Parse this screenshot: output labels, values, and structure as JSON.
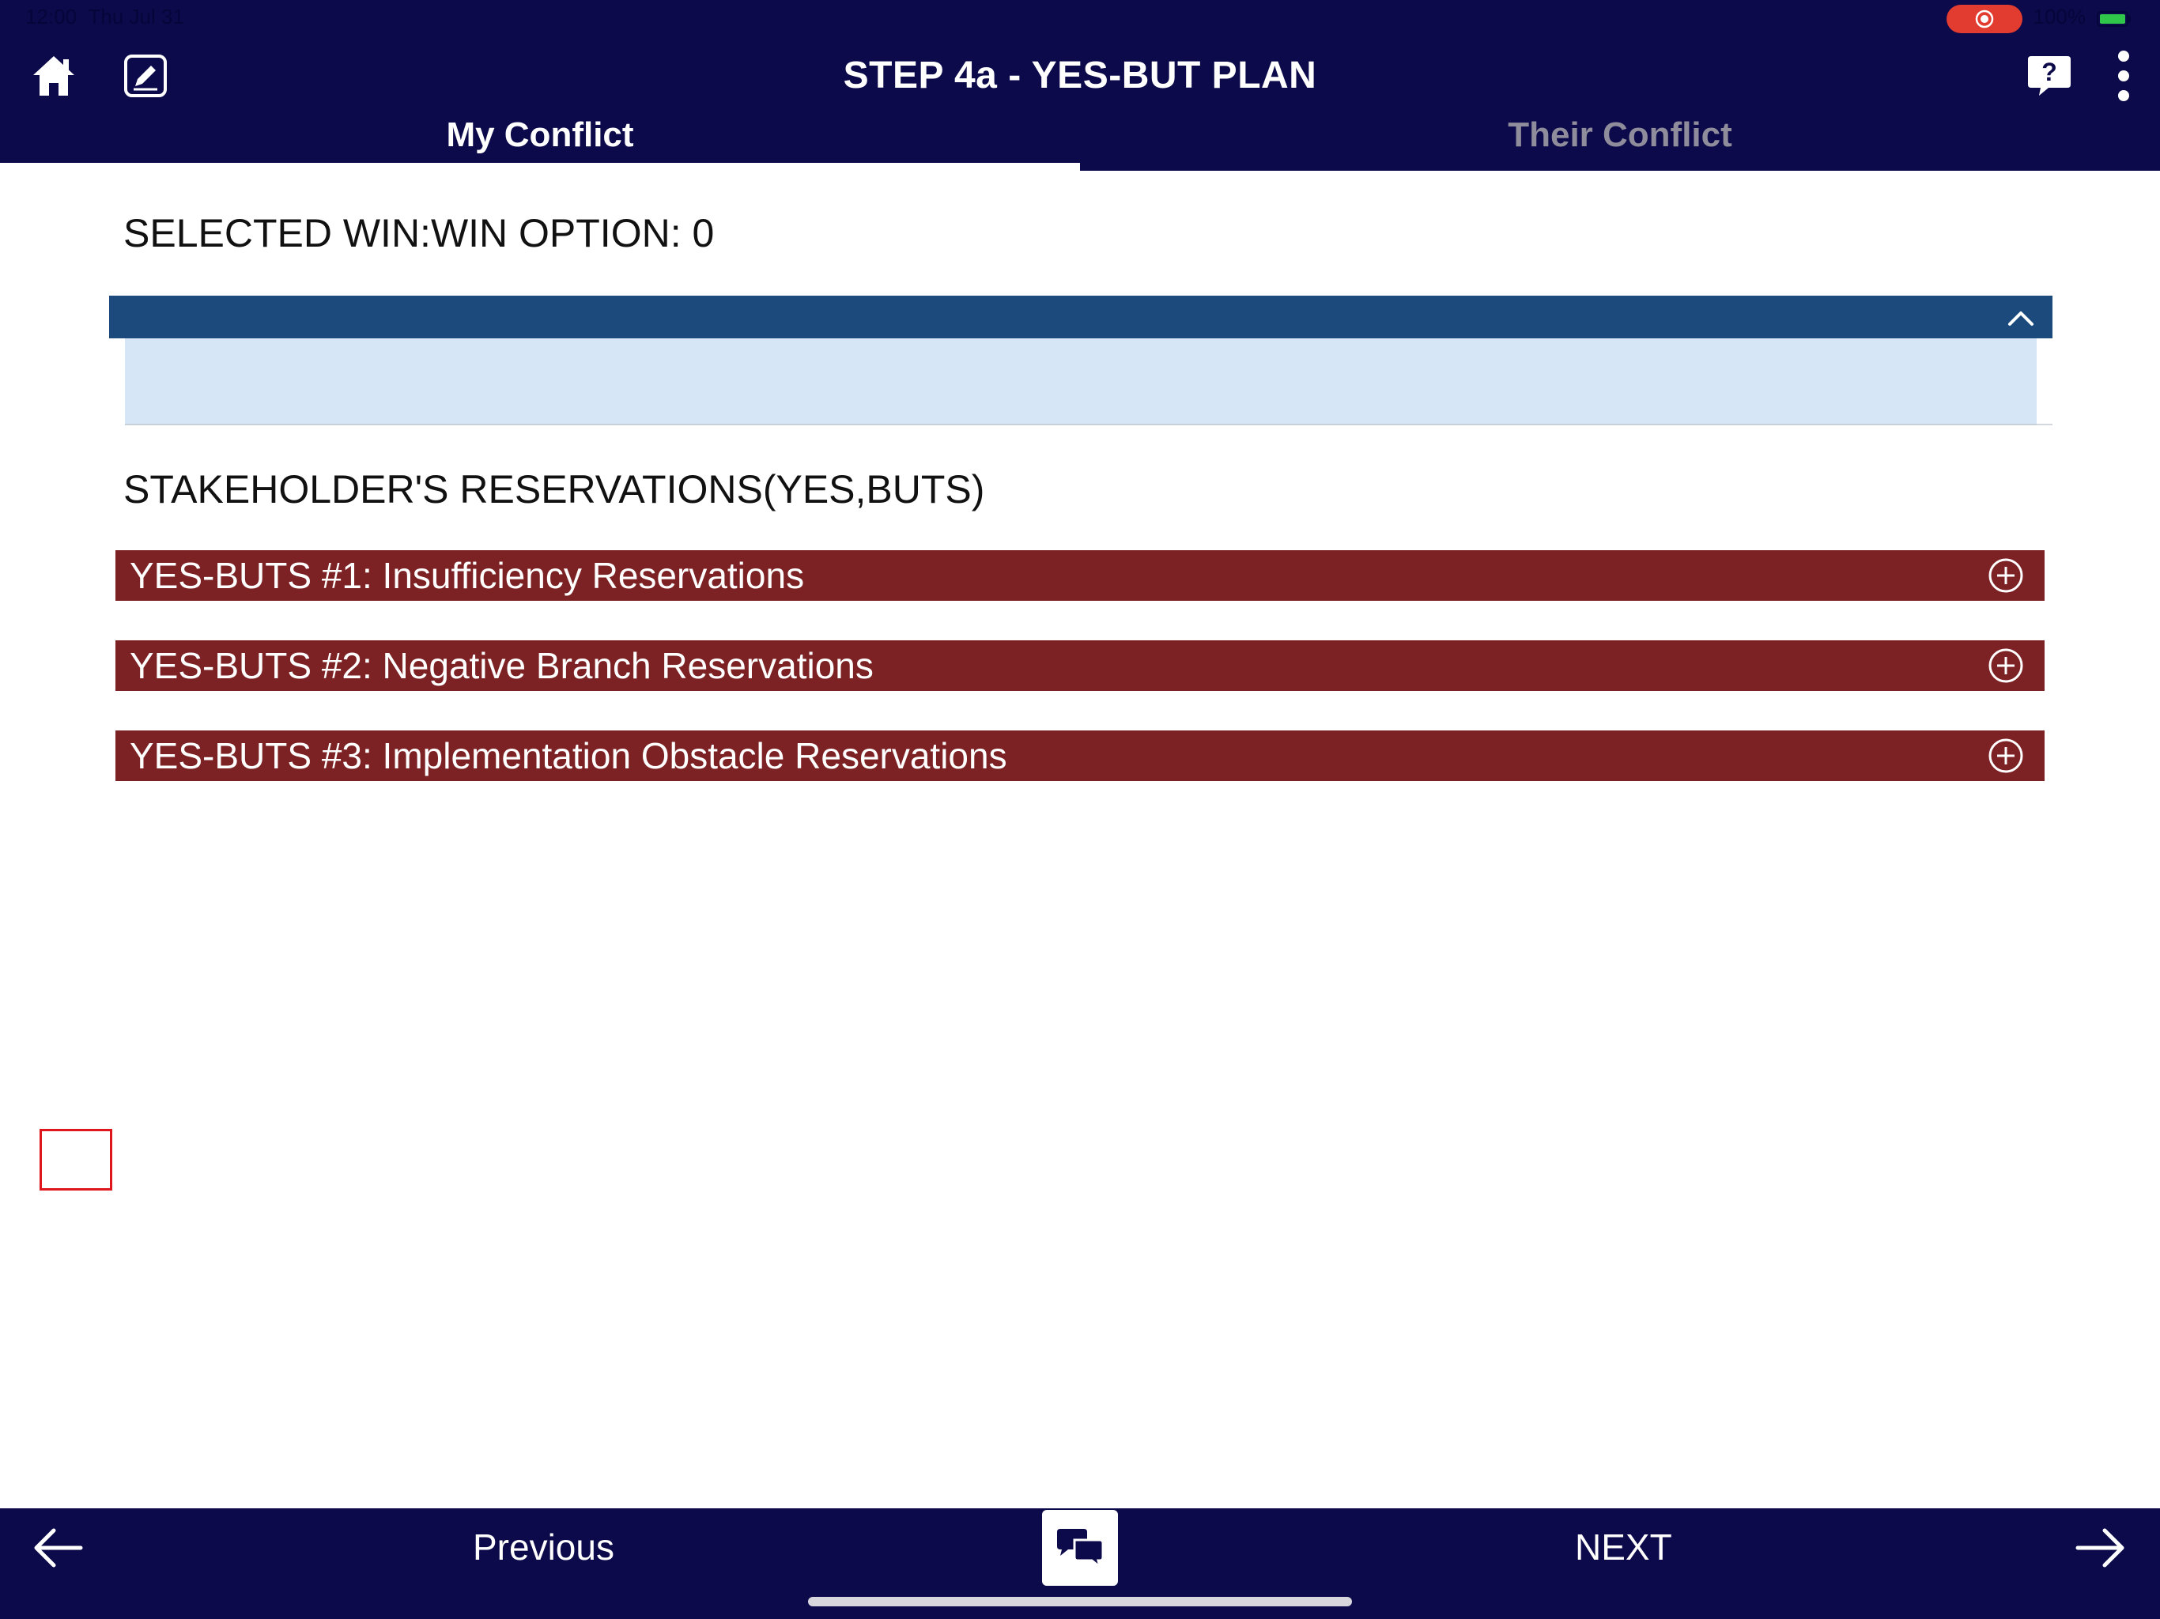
{
  "status_bar": {
    "time": "12:00",
    "date": "Thu Jul 31",
    "battery": "100%"
  },
  "header": {
    "title": "STEP 4a - YES-BUT PLAN"
  },
  "tabs": [
    {
      "label": "My Conflict",
      "active": true
    },
    {
      "label": "Their Conflict",
      "active": false
    }
  ],
  "main": {
    "selected_option_label": "SELECTED WIN:WIN OPTION: 0",
    "stakeholder_label": "STAKEHOLDER'S RESERVATIONS(YES,BUTS)",
    "yes_buts": [
      {
        "label": "YES-BUTS #1: Insufficiency Reservations"
      },
      {
        "label": "YES-BUTS #2: Negative Branch Reservations"
      },
      {
        "label": "YES-BUTS #3: Implementation Obstacle Reservations"
      }
    ]
  },
  "footer": {
    "previous_label": "Previous",
    "next_label": "NEXT"
  },
  "colors": {
    "nav_bg": "#0c0a4a",
    "section_header": "#1c4a7d",
    "section_body": "#d6e6f6",
    "yes_but_bg": "#7d2224",
    "recording": "#e23b30",
    "marker": "#e0161d"
  },
  "icons": {
    "home": "home-icon",
    "edit": "edit-icon",
    "help": "help-bubble-icon",
    "more": "more-vertical-icon",
    "collapse": "chevron-up-icon",
    "expand": "plus-circle-icon",
    "back": "arrow-left-icon",
    "forward": "arrow-right-icon",
    "chat": "chat-bubbles-icon"
  }
}
